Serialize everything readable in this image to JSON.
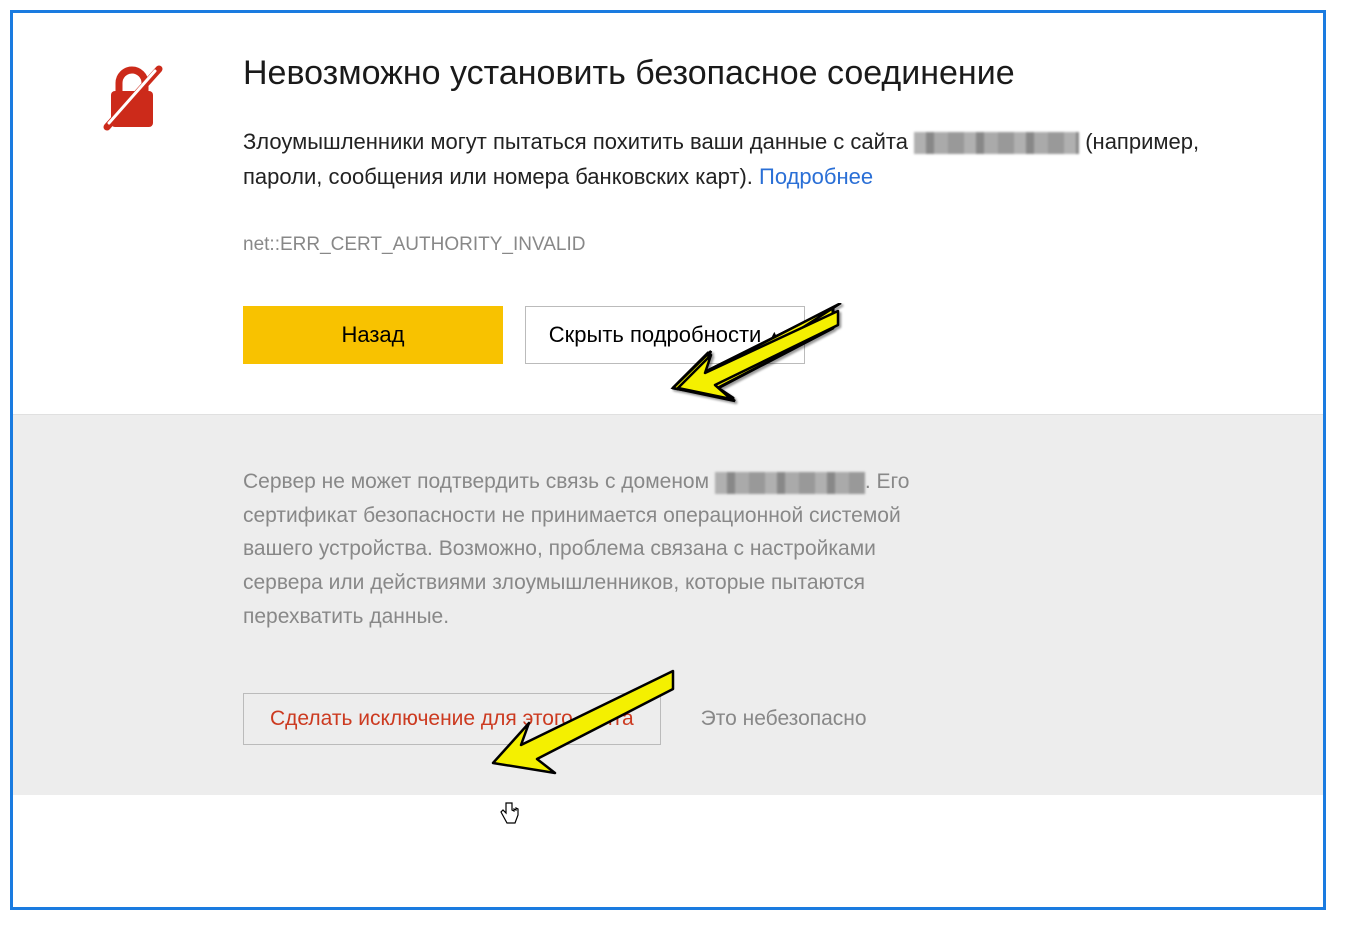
{
  "header": {
    "title": "Невозможно установить безопасное соединение"
  },
  "warning": {
    "text_before": "Злоумышленники могут пытаться похитить ваши данные с сайта ",
    "text_after": " (например, пароли, сообщения или номера банковских карт). ",
    "more_link": "Подробнее"
  },
  "error_code": "net::ERR_CERT_AUTHORITY_INVALID",
  "buttons": {
    "back": "Назад",
    "hide_details": "Скрыть подробности"
  },
  "details": {
    "text_before": "Сервер не может подтвердить связь с доменом ",
    "text_after": ". Его сертификат безопасности не принимается операционной системой вашего устройства. Возможно, проблема связана с настройками сервера или действиями злоумышленников, которые пытаются перехватить данные."
  },
  "bottom": {
    "make_exception": "Сделать исключение для этого сайта",
    "unsafe_label": "Это небезопасно"
  },
  "colors": {
    "frame": "#1a7be0",
    "primary_button": "#f8c200",
    "danger_text": "#cc3a20",
    "link": "#2a6fd6"
  }
}
